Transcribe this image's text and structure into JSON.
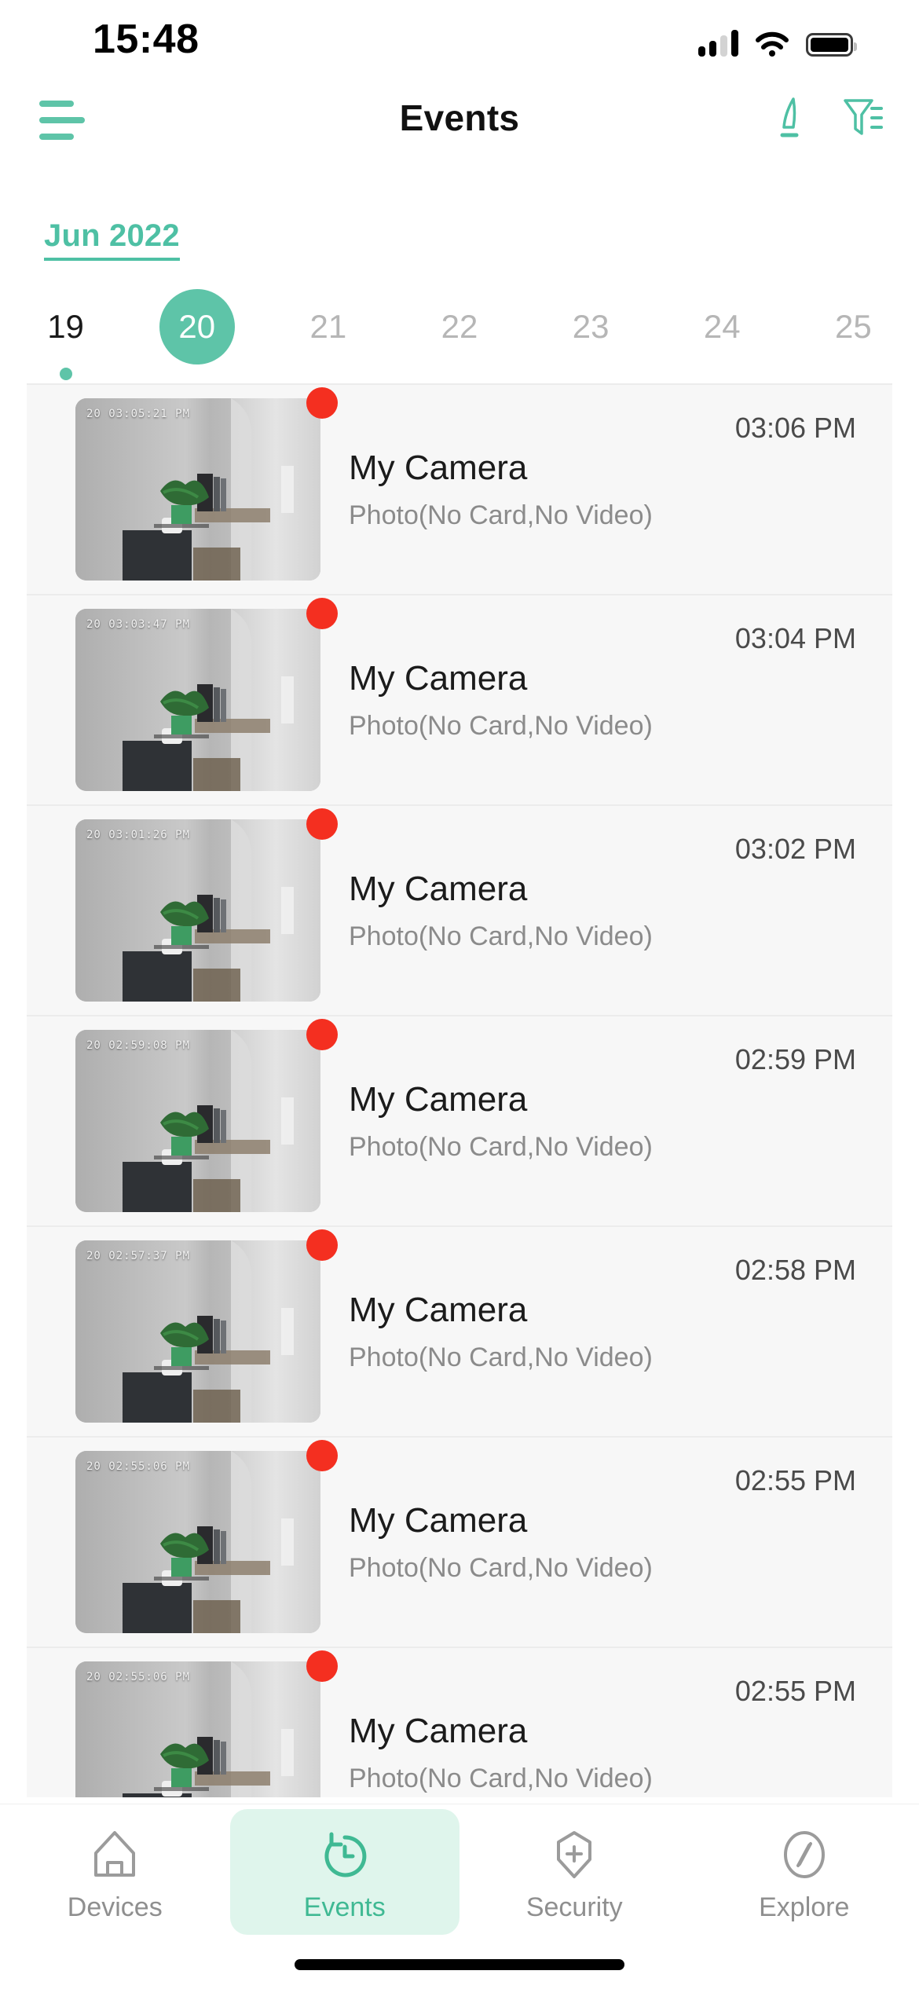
{
  "status_bar": {
    "time": "15:48",
    "signal_icon": "cellular-signal-icon",
    "wifi_icon": "wifi-icon",
    "battery_icon": "battery-icon"
  },
  "nav": {
    "menu_icon": "hamburger-menu-icon",
    "title": "Events",
    "edit_icon": "pencil-edit-icon",
    "filter_icon": "filter-icon"
  },
  "calendar": {
    "month_label": "Jun 2022",
    "days": [
      {
        "num": "19",
        "selected": false,
        "has_events": true
      },
      {
        "num": "20",
        "selected": true,
        "has_events": false
      },
      {
        "num": "21",
        "selected": false,
        "has_events": false
      },
      {
        "num": "22",
        "selected": false,
        "has_events": false
      },
      {
        "num": "23",
        "selected": false,
        "has_events": false
      },
      {
        "num": "24",
        "selected": false,
        "has_events": false
      },
      {
        "num": "25",
        "selected": false,
        "has_events": false
      }
    ]
  },
  "events": [
    {
      "time": "03:06 PM",
      "device": "My Camera",
      "type": "Photo(No Card,No Video)",
      "thumb_timestamp": "20 03:05:21 PM",
      "unread": true
    },
    {
      "time": "03:04 PM",
      "device": "My Camera",
      "type": "Photo(No Card,No Video)",
      "thumb_timestamp": "20 03:03:47 PM",
      "unread": true
    },
    {
      "time": "03:02 PM",
      "device": "My Camera",
      "type": "Photo(No Card,No Video)",
      "thumb_timestamp": "20 03:01:26 PM",
      "unread": true
    },
    {
      "time": "02:59 PM",
      "device": "My Camera",
      "type": "Photo(No Card,No Video)",
      "thumb_timestamp": "20 02:59:08 PM",
      "unread": true
    },
    {
      "time": "02:58 PM",
      "device": "My Camera",
      "type": "Photo(No Card,No Video)",
      "thumb_timestamp": "20 02:57:37 PM",
      "unread": true
    },
    {
      "time": "02:55 PM",
      "device": "My Camera",
      "type": "Photo(No Card,No Video)",
      "thumb_timestamp": "20 02:55:06 PM",
      "unread": true
    },
    {
      "time": "02:55 PM",
      "device": "My Camera",
      "type": "Photo(No Card,No Video)",
      "thumb_timestamp": "20 02:55:06 PM",
      "unread": true
    }
  ],
  "tabbar": {
    "items": [
      {
        "label": "Devices",
        "icon": "home-icon",
        "active": false
      },
      {
        "label": "Events",
        "icon": "clock-history-icon",
        "active": true
      },
      {
        "label": "Security",
        "icon": "shield-plus-icon",
        "active": false
      },
      {
        "label": "Explore",
        "icon": "compass-icon",
        "active": false
      }
    ]
  },
  "colors": {
    "accent": "#5ec4a8",
    "accent_dark": "#3fb993",
    "tab_active_bg": "#dff5ec",
    "row_bg": "#f7f7f7",
    "unread_dot": "#f42f20",
    "muted_text": "#8b8b8b"
  }
}
